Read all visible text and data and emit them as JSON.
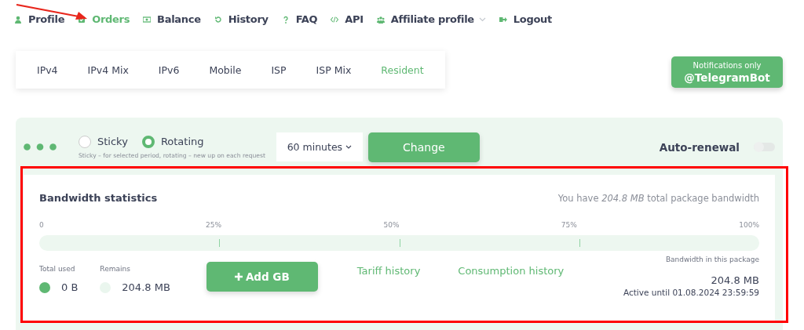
{
  "nav": [
    {
      "label": "Profile",
      "kind": "user",
      "selected": false
    },
    {
      "label": "Orders",
      "kind": "check",
      "selected": true
    },
    {
      "label": "Balance",
      "kind": "money",
      "selected": false
    },
    {
      "label": "History",
      "kind": "history",
      "selected": false
    },
    {
      "label": "FAQ",
      "kind": "question",
      "selected": false
    },
    {
      "label": "API",
      "kind": "code",
      "selected": false
    },
    {
      "label": "Affiliate profile",
      "kind": "users",
      "selected": false,
      "dropdown": true
    },
    {
      "label": "Logout",
      "kind": "logout",
      "selected": false
    }
  ],
  "tabs": [
    {
      "label": "IPv4",
      "selected": false
    },
    {
      "label": "IPv4 Mix",
      "selected": false
    },
    {
      "label": "IPv6",
      "selected": false
    },
    {
      "label": "Mobile",
      "selected": false
    },
    {
      "label": "ISP",
      "selected": false
    },
    {
      "label": "ISP Mix",
      "selected": false
    },
    {
      "label": "Resident",
      "selected": true
    }
  ],
  "notify_button": {
    "caption": "Notifications only",
    "label": "@TelegramBot"
  },
  "settings": {
    "modes": [
      {
        "label": "Sticky",
        "selected": false
      },
      {
        "label": "Rotating",
        "selected": true
      }
    ],
    "hint": "Sticky – for selected period, rotating – new up on each request",
    "period": "60 minutes",
    "change_button": "Change",
    "auto_renewal": {
      "label": "Auto-renewal",
      "on": false
    }
  },
  "bandwidth": {
    "title": "Bandwidth statistics",
    "summary": "You have *204.8 MB* total package bandwidth",
    "scale": [
      "0",
      "25%",
      "50%",
      "75%",
      "100%"
    ],
    "stats": [
      {
        "label": "Total used",
        "value": "0 B",
        "color": "#5fb873"
      },
      {
        "label": "Remains",
        "value": "204.8 MB",
        "color": "#eaf6ee"
      }
    ],
    "add_button": "Add GB",
    "links": [
      "Tariff history",
      "Consumption history"
    ],
    "package": {
      "label": "Bandwidth in this package",
      "value": "204.8 MB",
      "active": "Active until 01.08.2024 23:59:59"
    }
  }
}
